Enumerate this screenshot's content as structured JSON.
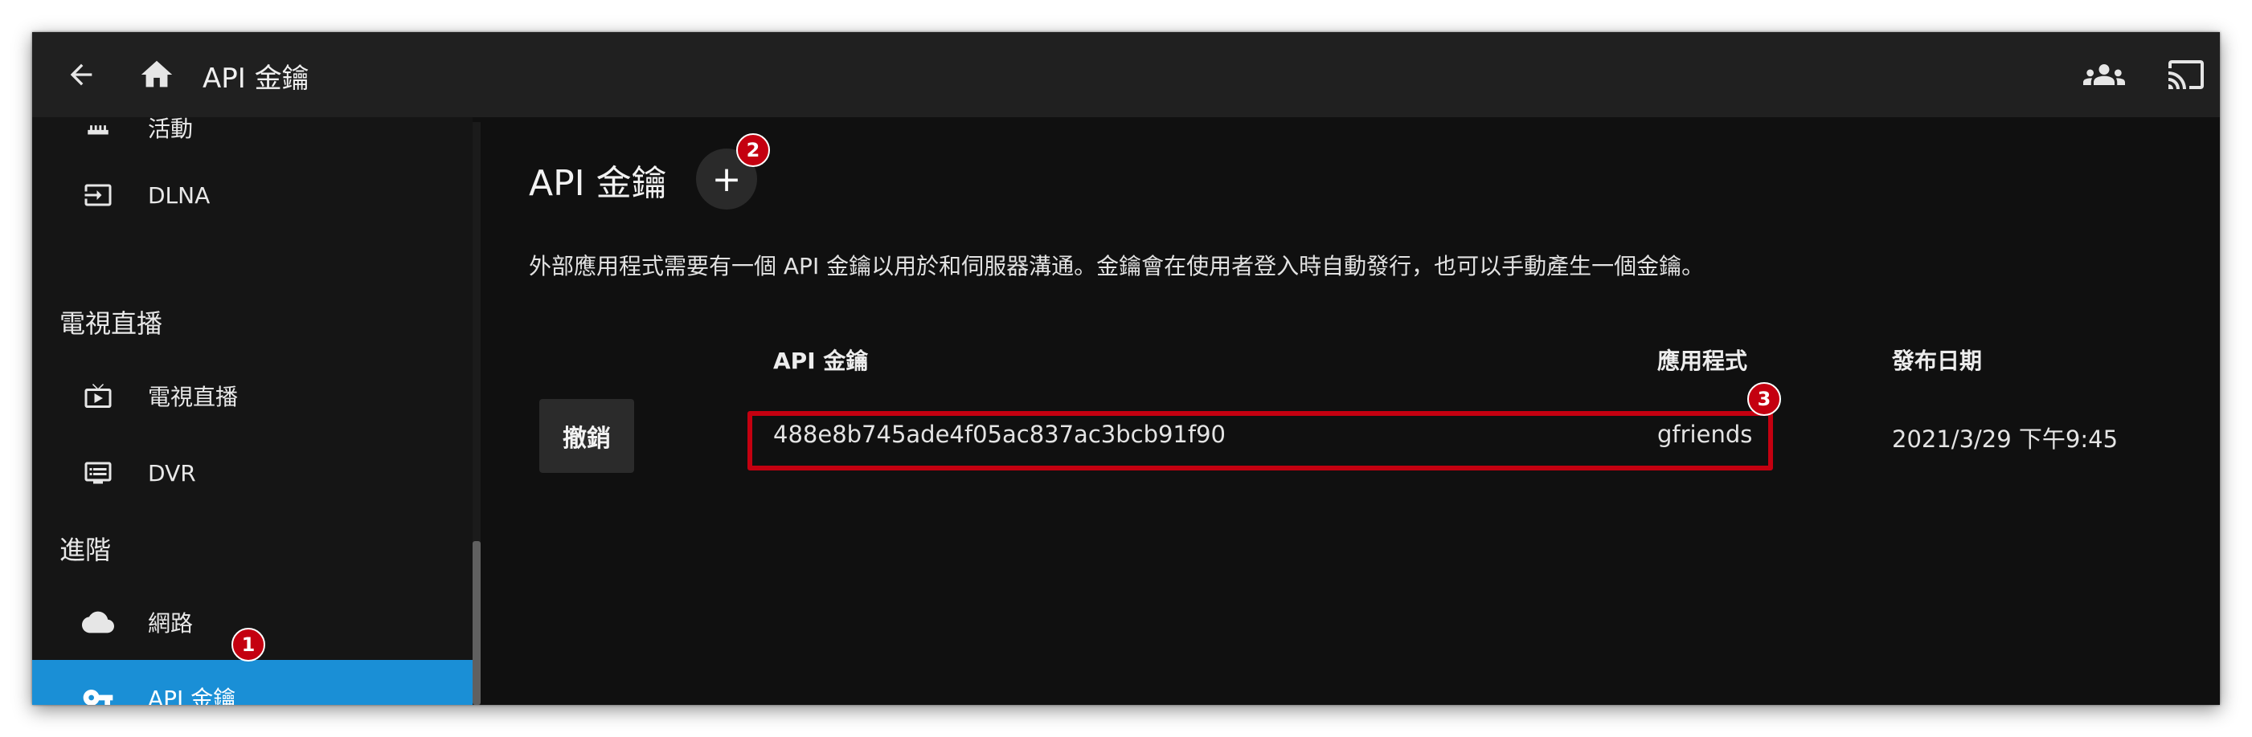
{
  "header": {
    "back_icon": "arrow-left-icon",
    "home_icon": "home-icon",
    "title": "API 金鑰",
    "users_icon": "users-icon",
    "cast_icon": "cast-icon"
  },
  "sidebar": {
    "items": [
      {
        "label": "活動",
        "icon": "activity-icon"
      },
      {
        "label": "DLNA",
        "icon": "input-icon"
      },
      {
        "label": "電視直播",
        "icon": "live-tv-icon"
      },
      {
        "label": "DVR",
        "icon": "dvr-icon"
      },
      {
        "label": "網路",
        "icon": "cloud-icon"
      },
      {
        "label": "API 金鑰",
        "icon": "key-icon"
      }
    ],
    "sections": [
      "電視直播",
      "進階"
    ]
  },
  "main": {
    "title": "API 金鑰",
    "add_label": "+",
    "description": "外部應用程式需要有一個 API 金鑰以用於和伺服器溝通。金鑰會在使用者登入時自動發行，也可以手動產生一個金鑰。",
    "table": {
      "headers": [
        "API 金鑰",
        "應用程式",
        "發布日期"
      ],
      "rows": [
        {
          "action": "撤銷",
          "key": "488e8b745ade4f05ac837ac3bcb91f90",
          "app": "gfriends",
          "date": "2021/3/29 下午9:45"
        }
      ]
    }
  },
  "badges": [
    "1",
    "2",
    "3"
  ],
  "colors": {
    "accent": "#1a8fd6",
    "badge": "#c40010",
    "highlight": "#c40010"
  }
}
